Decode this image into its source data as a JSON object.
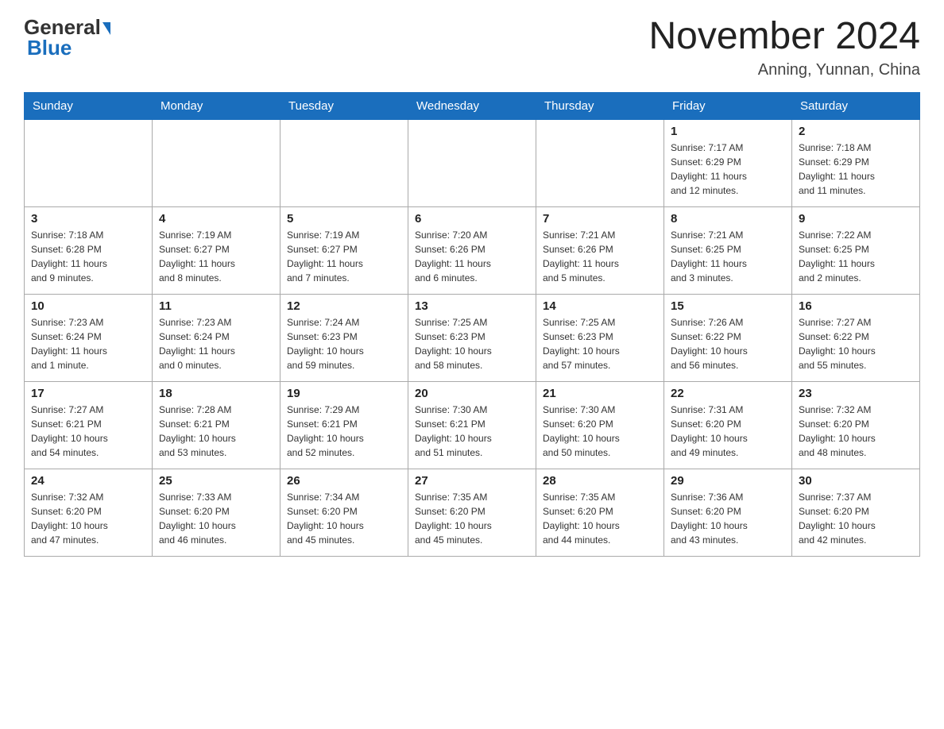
{
  "header": {
    "logo_text_general": "General",
    "logo_text_blue": "Blue",
    "month_title": "November 2024",
    "location": "Anning, Yunnan, China"
  },
  "calendar": {
    "days_of_week": [
      "Sunday",
      "Monday",
      "Tuesday",
      "Wednesday",
      "Thursday",
      "Friday",
      "Saturday"
    ],
    "weeks": [
      {
        "days": [
          {
            "num": "",
            "info": ""
          },
          {
            "num": "",
            "info": ""
          },
          {
            "num": "",
            "info": ""
          },
          {
            "num": "",
            "info": ""
          },
          {
            "num": "",
            "info": ""
          },
          {
            "num": "1",
            "info": "Sunrise: 7:17 AM\nSunset: 6:29 PM\nDaylight: 11 hours\nand 12 minutes."
          },
          {
            "num": "2",
            "info": "Sunrise: 7:18 AM\nSunset: 6:29 PM\nDaylight: 11 hours\nand 11 minutes."
          }
        ]
      },
      {
        "days": [
          {
            "num": "3",
            "info": "Sunrise: 7:18 AM\nSunset: 6:28 PM\nDaylight: 11 hours\nand 9 minutes."
          },
          {
            "num": "4",
            "info": "Sunrise: 7:19 AM\nSunset: 6:27 PM\nDaylight: 11 hours\nand 8 minutes."
          },
          {
            "num": "5",
            "info": "Sunrise: 7:19 AM\nSunset: 6:27 PM\nDaylight: 11 hours\nand 7 minutes."
          },
          {
            "num": "6",
            "info": "Sunrise: 7:20 AM\nSunset: 6:26 PM\nDaylight: 11 hours\nand 6 minutes."
          },
          {
            "num": "7",
            "info": "Sunrise: 7:21 AM\nSunset: 6:26 PM\nDaylight: 11 hours\nand 5 minutes."
          },
          {
            "num": "8",
            "info": "Sunrise: 7:21 AM\nSunset: 6:25 PM\nDaylight: 11 hours\nand 3 minutes."
          },
          {
            "num": "9",
            "info": "Sunrise: 7:22 AM\nSunset: 6:25 PM\nDaylight: 11 hours\nand 2 minutes."
          }
        ]
      },
      {
        "days": [
          {
            "num": "10",
            "info": "Sunrise: 7:23 AM\nSunset: 6:24 PM\nDaylight: 11 hours\nand 1 minute."
          },
          {
            "num": "11",
            "info": "Sunrise: 7:23 AM\nSunset: 6:24 PM\nDaylight: 11 hours\nand 0 minutes."
          },
          {
            "num": "12",
            "info": "Sunrise: 7:24 AM\nSunset: 6:23 PM\nDaylight: 10 hours\nand 59 minutes."
          },
          {
            "num": "13",
            "info": "Sunrise: 7:25 AM\nSunset: 6:23 PM\nDaylight: 10 hours\nand 58 minutes."
          },
          {
            "num": "14",
            "info": "Sunrise: 7:25 AM\nSunset: 6:23 PM\nDaylight: 10 hours\nand 57 minutes."
          },
          {
            "num": "15",
            "info": "Sunrise: 7:26 AM\nSunset: 6:22 PM\nDaylight: 10 hours\nand 56 minutes."
          },
          {
            "num": "16",
            "info": "Sunrise: 7:27 AM\nSunset: 6:22 PM\nDaylight: 10 hours\nand 55 minutes."
          }
        ]
      },
      {
        "days": [
          {
            "num": "17",
            "info": "Sunrise: 7:27 AM\nSunset: 6:21 PM\nDaylight: 10 hours\nand 54 minutes."
          },
          {
            "num": "18",
            "info": "Sunrise: 7:28 AM\nSunset: 6:21 PM\nDaylight: 10 hours\nand 53 minutes."
          },
          {
            "num": "19",
            "info": "Sunrise: 7:29 AM\nSunset: 6:21 PM\nDaylight: 10 hours\nand 52 minutes."
          },
          {
            "num": "20",
            "info": "Sunrise: 7:30 AM\nSunset: 6:21 PM\nDaylight: 10 hours\nand 51 minutes."
          },
          {
            "num": "21",
            "info": "Sunrise: 7:30 AM\nSunset: 6:20 PM\nDaylight: 10 hours\nand 50 minutes."
          },
          {
            "num": "22",
            "info": "Sunrise: 7:31 AM\nSunset: 6:20 PM\nDaylight: 10 hours\nand 49 minutes."
          },
          {
            "num": "23",
            "info": "Sunrise: 7:32 AM\nSunset: 6:20 PM\nDaylight: 10 hours\nand 48 minutes."
          }
        ]
      },
      {
        "days": [
          {
            "num": "24",
            "info": "Sunrise: 7:32 AM\nSunset: 6:20 PM\nDaylight: 10 hours\nand 47 minutes."
          },
          {
            "num": "25",
            "info": "Sunrise: 7:33 AM\nSunset: 6:20 PM\nDaylight: 10 hours\nand 46 minutes."
          },
          {
            "num": "26",
            "info": "Sunrise: 7:34 AM\nSunset: 6:20 PM\nDaylight: 10 hours\nand 45 minutes."
          },
          {
            "num": "27",
            "info": "Sunrise: 7:35 AM\nSunset: 6:20 PM\nDaylight: 10 hours\nand 45 minutes."
          },
          {
            "num": "28",
            "info": "Sunrise: 7:35 AM\nSunset: 6:20 PM\nDaylight: 10 hours\nand 44 minutes."
          },
          {
            "num": "29",
            "info": "Sunrise: 7:36 AM\nSunset: 6:20 PM\nDaylight: 10 hours\nand 43 minutes."
          },
          {
            "num": "30",
            "info": "Sunrise: 7:37 AM\nSunset: 6:20 PM\nDaylight: 10 hours\nand 42 minutes."
          }
        ]
      }
    ]
  }
}
